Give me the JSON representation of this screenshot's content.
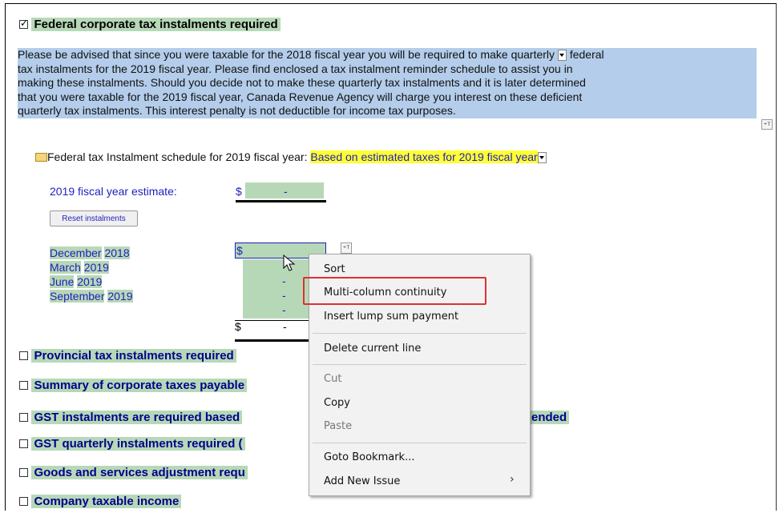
{
  "federal": {
    "checkbox_checked": true,
    "heading": "Federal corporate tax instalments required",
    "paragraph": {
      "line1": "Please be advised that since you were taxable for the 2018 fiscal year you will be required to make quarterly",
      "line1b": "federal",
      "line2": "tax instalments for the 2019 fiscal year. Please find enclosed a tax instalment reminder schedule to assist you in",
      "line3": "making these instalments. Should you decide not to make these quarterly tax instalments and it is later determined",
      "line4": "that you were taxable for the 2019 fiscal year, Canada Revenue Agency will charge you interest on these deficient",
      "line5": "quarterly tax instalments.  This interest penalty is not deductible for income tax purposes."
    },
    "schedule": {
      "label": "Federal tax Instalment schedule for 2019 fiscal year:",
      "selected": "Based on estimated taxes for 2019 fiscal year",
      "estimate_label": "2019 fiscal year estimate:",
      "estimate_currency": "$",
      "estimate_value": "-",
      "reset_button": "Reset instalments",
      "rows": [
        {
          "month": "December",
          "year": "2018",
          "currency": "$",
          "value": ""
        },
        {
          "month": "March",
          "year": "2019",
          "value": "-"
        },
        {
          "month": "June",
          "year": "2019",
          "value": "-"
        },
        {
          "month": "September",
          "year": "2019",
          "value": "-"
        }
      ],
      "total_currency": "$",
      "total_value": "-"
    }
  },
  "sections": [
    {
      "label": "Provincial tax instalments required"
    },
    {
      "label": "Summary of corporate taxes payable"
    },
    {
      "label": "GST instalments are required based",
      "suffix": "ended"
    },
    {
      "label": "GST quarterly instalments required ("
    },
    {
      "label": "Goods and services adjustment requ"
    },
    {
      "label": "Company taxable income"
    }
  ],
  "context_menu": {
    "items": [
      {
        "label": "Sort",
        "disabled": false
      },
      {
        "label": "Multi-column continuity",
        "disabled": false,
        "highlighted": true
      },
      {
        "label": "Insert lump sum payment",
        "disabled": false
      },
      {
        "label": "Delete current line",
        "disabled": false
      },
      {
        "label": "Cut",
        "disabled": true
      },
      {
        "label": "Copy",
        "disabled": false
      },
      {
        "label": "Paste",
        "disabled": true
      },
      {
        "label": "Goto Bookmark...",
        "disabled": false
      },
      {
        "label": "Add New Issue",
        "disabled": false,
        "submenu": true
      }
    ],
    "submenu_arrow": "›"
  },
  "colors": {
    "heading_bg": "#b7d8b7",
    "paragraph_bg": "#b3cdea",
    "dropdown_highlight": "#ffff33",
    "link_blue": "#1f1fbf",
    "callout_red": "#e03030"
  }
}
